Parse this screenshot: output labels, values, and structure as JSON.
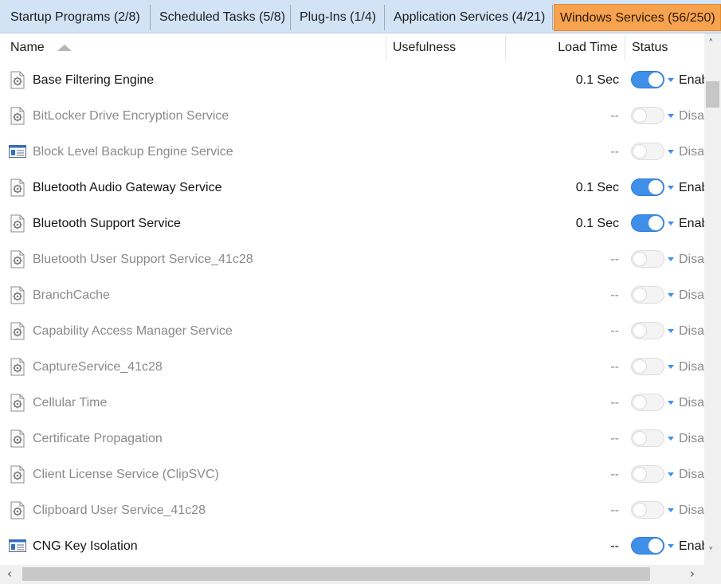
{
  "tabs": [
    {
      "label": "Startup Programs (2/8)",
      "active": false
    },
    {
      "label": "Scheduled Tasks (5/8)",
      "active": false
    },
    {
      "label": "Plug-Ins (1/4)",
      "active": false
    },
    {
      "label": "Application Services (4/21)",
      "active": false
    },
    {
      "label": "Windows Services (56/250)",
      "active": true
    }
  ],
  "columns": {
    "name": "Name",
    "usefulness": "Usefulness",
    "load_time": "Load Time",
    "status": "Status"
  },
  "rows": [
    {
      "name": "Base Filtering Engine",
      "load_time": "0.1 Sec",
      "status": "Enabled",
      "enabled": true,
      "icon": "service-icon"
    },
    {
      "name": "BitLocker Drive Encryption Service",
      "load_time": "--",
      "status": "Disabled",
      "enabled": false,
      "icon": "service-icon"
    },
    {
      "name": "Block Level Backup Engine Service",
      "load_time": "--",
      "status": "Disabled",
      "enabled": false,
      "icon": "window-app-icon"
    },
    {
      "name": "Bluetooth Audio Gateway Service",
      "load_time": "0.1 Sec",
      "status": "Enabled",
      "enabled": true,
      "icon": "service-icon"
    },
    {
      "name": "Bluetooth Support Service",
      "load_time": "0.1 Sec",
      "status": "Enabled",
      "enabled": true,
      "icon": "service-icon"
    },
    {
      "name": "Bluetooth User Support Service_41c28",
      "load_time": "--",
      "status": "Disabled",
      "enabled": false,
      "icon": "service-icon"
    },
    {
      "name": "BranchCache",
      "load_time": "--",
      "status": "Disabled",
      "enabled": false,
      "icon": "service-icon"
    },
    {
      "name": "Capability Access Manager Service",
      "load_time": "--",
      "status": "Disabled",
      "enabled": false,
      "icon": "service-icon"
    },
    {
      "name": "CaptureService_41c28",
      "load_time": "--",
      "status": "Disabled",
      "enabled": false,
      "icon": "service-icon"
    },
    {
      "name": "Cellular Time",
      "load_time": "--",
      "status": "Disabled",
      "enabled": false,
      "icon": "service-icon"
    },
    {
      "name": "Certificate Propagation",
      "load_time": "--",
      "status": "Disabled",
      "enabled": false,
      "icon": "service-icon"
    },
    {
      "name": "Client License Service (ClipSVC)",
      "load_time": "--",
      "status": "Disabled",
      "enabled": false,
      "icon": "service-icon"
    },
    {
      "name": "Clipboard User Service_41c28",
      "load_time": "--",
      "status": "Disabled",
      "enabled": false,
      "icon": "service-icon"
    },
    {
      "name": "CNG Key Isolation",
      "load_time": "--",
      "status": "Enabled",
      "enabled": true,
      "icon": "window-app-icon"
    }
  ],
  "colors": {
    "accent": "#3f8fe8",
    "active_tab": "#f7a24e",
    "tabbar": "#d2e3f6"
  }
}
